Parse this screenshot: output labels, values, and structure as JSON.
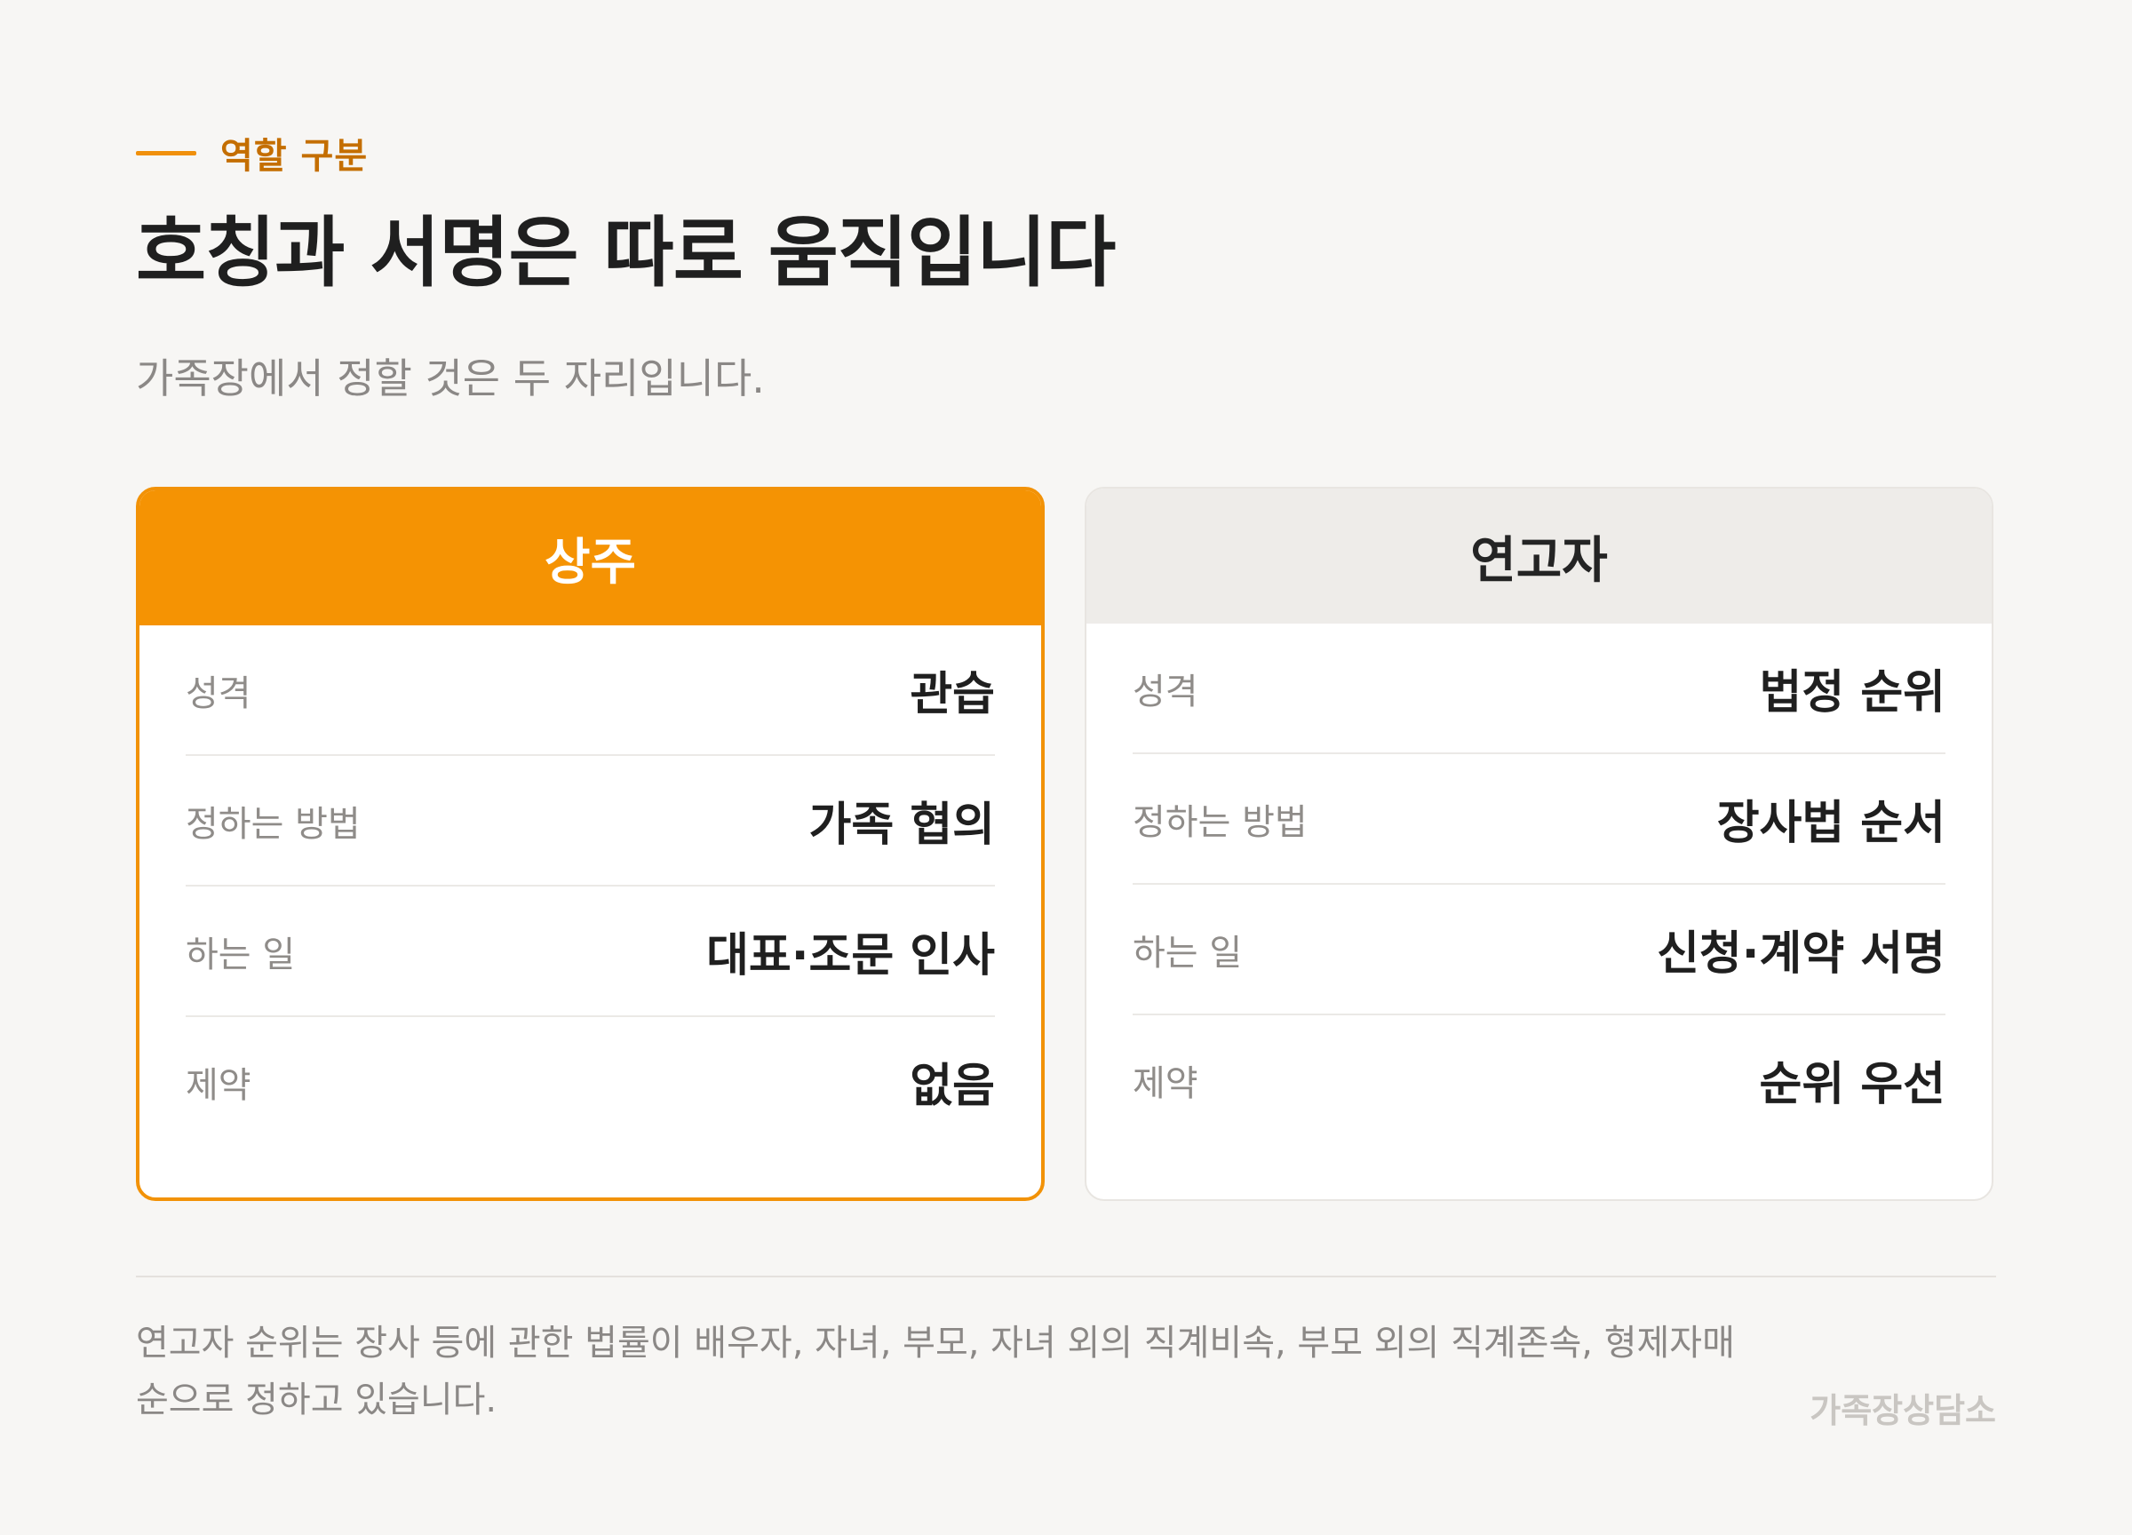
{
  "header": {
    "eyebrow": "역할 구분",
    "title": "호칭과 서명은 따로 움직입니다",
    "subtitle": "가족장에서 정할 것은 두 자리입니다."
  },
  "cards": [
    {
      "title": "상주",
      "rows": [
        {
          "label": "성격",
          "value": "관습"
        },
        {
          "label": "정하는 방법",
          "value": "가족 협의"
        },
        {
          "label": "하는 일",
          "value": "대표·조문 인사"
        },
        {
          "label": "제약",
          "value": "없음"
        }
      ]
    },
    {
      "title": "연고자",
      "rows": [
        {
          "label": "성격",
          "value": "법정 순위"
        },
        {
          "label": "정하는 방법",
          "value": "장사법 순서"
        },
        {
          "label": "하는 일",
          "value": "신청·계약 서명"
        },
        {
          "label": "제약",
          "value": "순위 우선"
        }
      ]
    }
  ],
  "footer": {
    "note": "연고자 순위는 장사 등에 관한 법률이 배우자, 자녀, 부모, 자녀 외의 직계비속, 부모 외의 직계존속, 형제자매 순으로 정하고 있습니다.",
    "brand": "가족장상담소"
  },
  "colors": {
    "accent": "#f59303",
    "accent_text": "#c46e00",
    "background": "#f7f6f4",
    "secondary_head": "#eeece9"
  }
}
